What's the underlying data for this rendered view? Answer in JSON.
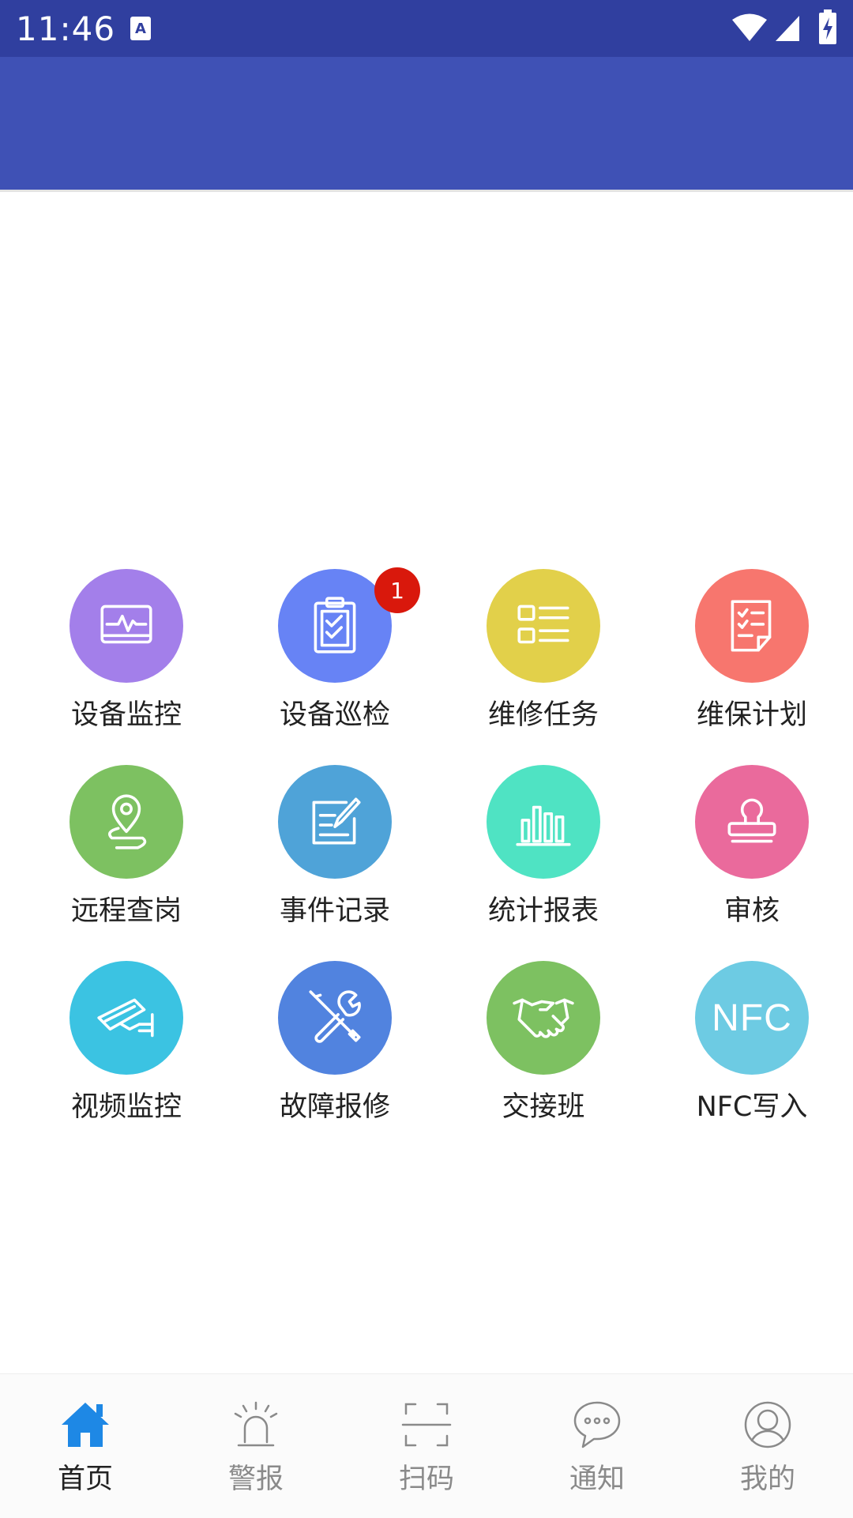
{
  "status_bar": {
    "time": "11:46"
  },
  "grid": [
    {
      "label": "设备监控",
      "icon": "monitor-pulse-icon",
      "color": "#A37FEA"
    },
    {
      "label": "设备巡检",
      "icon": "clipboard-check-icon",
      "color": "#6783F5",
      "badge": "1"
    },
    {
      "label": "维修任务",
      "icon": "task-list-icon",
      "color": "#E2D04A"
    },
    {
      "label": "维保计划",
      "icon": "plan-document-icon",
      "color": "#F7766E"
    },
    {
      "label": "远程查岗",
      "icon": "location-pin-icon",
      "color": "#7DC161"
    },
    {
      "label": "事件记录",
      "icon": "edit-record-icon",
      "color": "#4FA3D8"
    },
    {
      "label": "统计报表",
      "icon": "bar-chart-icon",
      "color": "#4FE3C3"
    },
    {
      "label": "审核",
      "icon": "stamp-icon",
      "color": "#EA6A9C"
    },
    {
      "label": "视频监控",
      "icon": "cctv-camera-icon",
      "color": "#3BC3E2"
    },
    {
      "label": "故障报修",
      "icon": "repair-tools-icon",
      "color": "#5183DF"
    },
    {
      "label": "交接班",
      "icon": "handshake-icon",
      "color": "#7DC161"
    },
    {
      "label": "NFC写入",
      "icon": "nfc-icon",
      "color": "#6DCBE3",
      "icon_text": "NFC"
    }
  ],
  "bottom_nav": [
    {
      "label": "首页",
      "icon": "home-icon",
      "active": true
    },
    {
      "label": "警报",
      "icon": "alarm-light-icon"
    },
    {
      "label": "扫码",
      "icon": "scan-icon"
    },
    {
      "label": "通知",
      "icon": "chat-bubble-icon"
    },
    {
      "label": "我的",
      "icon": "user-icon"
    }
  ],
  "colors": {
    "status_bar": "#303F9F",
    "toolbar": "#3F51B5",
    "active_nav": "#1E88E5",
    "inactive_nav": "#8A8A8A",
    "badge": "#D9180C"
  }
}
